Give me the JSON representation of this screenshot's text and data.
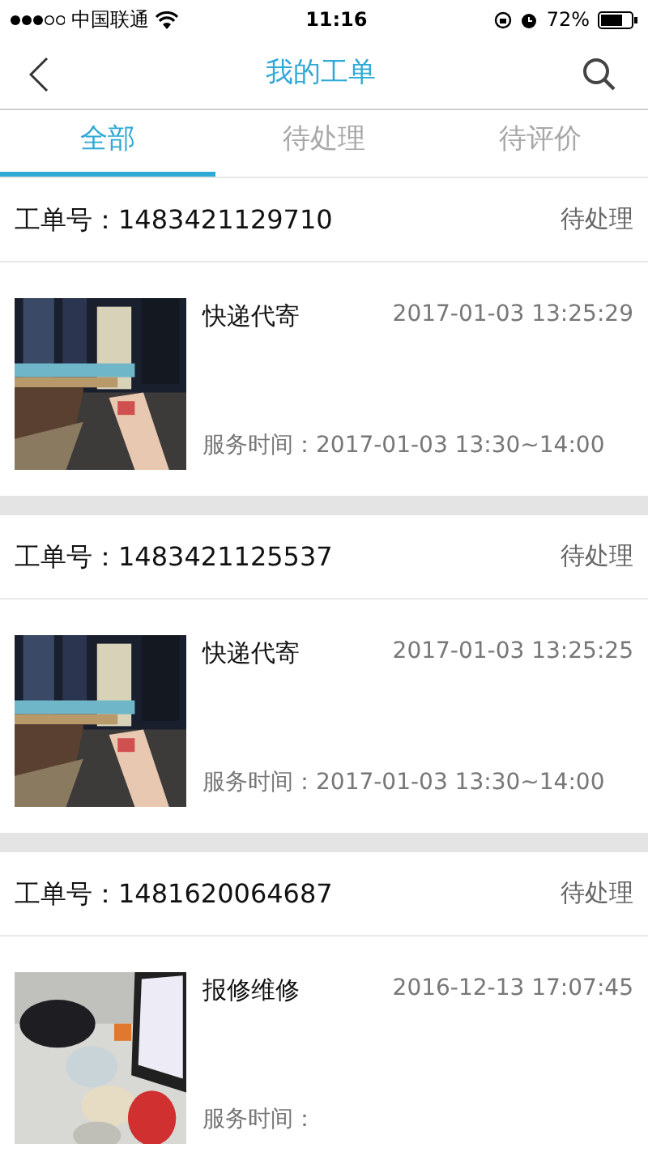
{
  "status_bar": {
    "carrier": "中国联通",
    "time": "11:16",
    "battery": "72%"
  },
  "nav": {
    "title": "我的工单"
  },
  "tabs": [
    {
      "label": "全部",
      "selected": true
    },
    {
      "label": "待处理",
      "selected": false
    },
    {
      "label": "待评价",
      "selected": false
    }
  ],
  "orders": [
    {
      "number_label": "工单号：",
      "number": "1483421129710",
      "status": "待处理",
      "service": "快递代寄",
      "created": "2017-01-03 13:25:29",
      "time_label": "服务时间：",
      "time": "2017-01-03 13:30~14:00"
    },
    {
      "number_label": "工单号：",
      "number": "1483421125537",
      "status": "待处理",
      "service": "快递代寄",
      "created": "2017-01-03 13:25:25",
      "time_label": "服务时间：",
      "time": "2017-01-03 13:30~14:00"
    },
    {
      "number_label": "工单号：",
      "number": "1481620064687",
      "status": "待处理",
      "service": "报修维修",
      "created": "2016-12-13 17:07:45",
      "time_label": "服务时间："
    }
  ]
}
